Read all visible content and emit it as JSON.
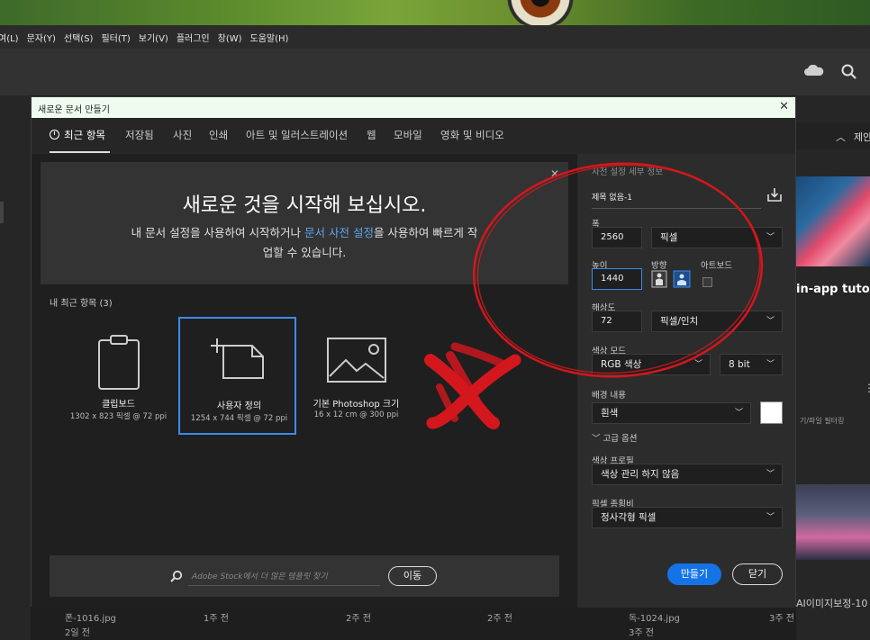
{
  "menubar": [
    "여(L)",
    "문자(Y)",
    "선택(S)",
    "필터(T)",
    "보기(V)",
    "플러그인",
    "창(W)",
    "도움말(H)"
  ],
  "dialog": {
    "title": "새로운 문서 만들기",
    "close_glyph": "✕",
    "tabs": [
      "최근 항목",
      "저장됨",
      "사진",
      "인쇄",
      "아트 및 일러스트레이션",
      "웹",
      "모바일",
      "영화 및 비디오"
    ],
    "hero": {
      "title": "새로운 것을 시작해 보십시오.",
      "line1_before": "내 문서 설정을 사용하여 시작하거나 ",
      "line1_link": "문서 사전 설정",
      "line1_after": "을 사용하여 빠르게 작",
      "line2": "업할 수 있습니다.",
      "close_glyph": "✕"
    },
    "recent_label": "내 최근 항목  (3)",
    "presets": [
      {
        "name": "클립보드",
        "size": "1302 x 823 픽셀 @ 72 ppi",
        "selected": false
      },
      {
        "name": "사용자 정의",
        "size": "1254 x 744 픽셀 @ 72 ppi",
        "selected": true
      },
      {
        "name": "기본 Photoshop 크기",
        "size": "16 x 12 cm @ 300 ppi",
        "selected": false
      }
    ],
    "stock": {
      "placeholder": "Adobe Stock에서 더 많은 템플릿 찾기",
      "go_label": "이동"
    },
    "details": {
      "header": "사전 설정 세부 정보",
      "doc_name": "제목 없음-1",
      "width_label": "폭",
      "width_value": "2560",
      "width_unit": "픽셀",
      "height_label": "높이",
      "height_value": "1440",
      "orientation_label": "방향",
      "artboard_label": "아트보드",
      "resolution_label": "해상도",
      "resolution_value": "72",
      "resolution_unit": "픽셀/인치",
      "color_mode_label": "색상 모드",
      "color_mode_value": "RGB 색상",
      "bit_depth": "8 bit",
      "background_label": "배경 내용",
      "background_value": "흰색",
      "background_color": "#ffffff",
      "advanced_label": "고급 옵션",
      "profile_label": "색상 프로필",
      "profile_value": "색상 관리 하지 않음",
      "pixel_ratio_label": "픽셀 종횡비",
      "pixel_ratio_value": "정사각형 픽셀",
      "create_label": "만들기",
      "close_label": "닫기"
    }
  },
  "right_panel": {
    "header": "제안",
    "tutorial": "in-app tutoria",
    "small_text": "기/파일 필터링",
    "bottom_text": "AI이미지보정-10"
  },
  "recent_files": [
    {
      "name": "폰-1016.jpg",
      "time": "2일 전"
    },
    {
      "name": "",
      "time": "1주 전"
    },
    {
      "name": "",
      "time": "2주 전"
    },
    {
      "name": "",
      "time": "2주 전"
    },
    {
      "name": "독-1024.jpg",
      "time": "3주 전"
    },
    {
      "name": "",
      "time": "3주 전"
    }
  ],
  "colors": {
    "accent": "#1473e6",
    "selection": "#3b8be8",
    "annotation": "#d3171d",
    "link": "#5da4ea"
  }
}
